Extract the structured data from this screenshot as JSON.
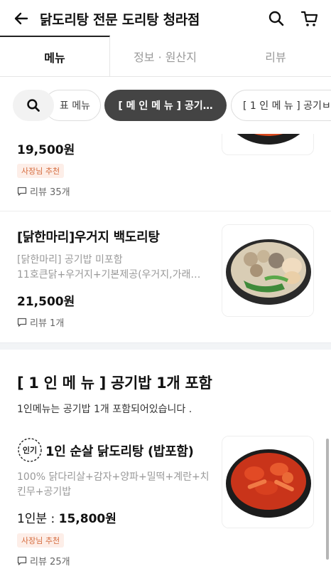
{
  "header": {
    "title": "닭도리탕 전문 도리탕 청라점"
  },
  "tabs": [
    {
      "label": "메뉴",
      "active": true
    },
    {
      "label": "정보 · 원산지",
      "active": false
    },
    {
      "label": "리뷰",
      "active": false
    }
  ],
  "chips": {
    "prev": "표 메뉴",
    "active": "[ 메 인 메 뉴 ] 공기…",
    "next": "[ 1 인 메 뉴 ] 공기ㅂ"
  },
  "items": [
    {
      "price": "19,500원",
      "badge": "사장님 추천",
      "review": "리뷰 35개"
    },
    {
      "name": "[닭한마리]우거지 백도리탕",
      "desc_line1": "[닭한마리]  공기밥 미포함",
      "desc_line2": "11호큰닭+우거지+기본제공(우거지,가래…",
      "price": "21,500원",
      "review": "리뷰 1개"
    }
  ],
  "section": {
    "title": "[ 1 인 메 뉴 ] 공기밥 1개 포함",
    "desc": "1인메뉴는 공기밥 1개 포함되어있습니다 ."
  },
  "section_item": {
    "popular_label": "인기",
    "name": "1인 순살 닭도리탕 (밥포함)",
    "desc_line1": "100% 닭다리살+감자+양파+밀떡+계란+치",
    "desc_line2": "킨무+공기밥",
    "price_prefix": "1인분 : ",
    "price": "15,800원",
    "badge": "사장님 추천",
    "review": "리뷰 25개"
  },
  "colors": {
    "active_chip": "#444444",
    "badge_bg": "#fdeee8",
    "badge_text": "#d56a3c"
  },
  "icons": {
    "back": "arrow-left-icon",
    "search": "search-icon",
    "cart": "cart-icon",
    "review": "speech-bubble-icon"
  }
}
